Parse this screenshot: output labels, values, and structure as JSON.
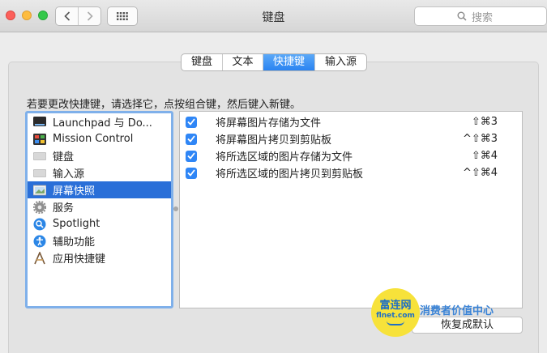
{
  "window": {
    "title": "键盘"
  },
  "search": {
    "placeholder": "搜索"
  },
  "tabs": [
    {
      "label": "键盘",
      "active": false
    },
    {
      "label": "文本",
      "active": false
    },
    {
      "label": "快捷键",
      "active": true
    },
    {
      "label": "输入源",
      "active": false
    }
  ],
  "instruction": "若要更改快捷键，请选择它，点按组合键，然后键入新键。",
  "categories": [
    {
      "label": "Launchpad 与 Do...",
      "icon": "launchpad-icon"
    },
    {
      "label": "Mission Control",
      "icon": "mission-control-icon"
    },
    {
      "label": "键盘",
      "icon": "keyboard-icon"
    },
    {
      "label": "输入源",
      "icon": "input-source-icon"
    },
    {
      "label": "屏幕快照",
      "icon": "screenshot-icon",
      "selected": true
    },
    {
      "label": "服务",
      "icon": "services-gear-icon"
    },
    {
      "label": "Spotlight",
      "icon": "spotlight-icon"
    },
    {
      "label": "辅助功能",
      "icon": "accessibility-icon"
    },
    {
      "label": "应用快捷键",
      "icon": "app-shortcuts-icon"
    }
  ],
  "shortcuts": [
    {
      "label": "将屏幕图片存储为文件",
      "keys": "⇧⌘3",
      "checked": true
    },
    {
      "label": "将屏幕图片拷贝到剪贴板",
      "keys": "^⇧⌘3",
      "checked": true
    },
    {
      "label": "将所选区域的图片存储为文件",
      "keys": "⇧⌘4",
      "checked": true
    },
    {
      "label": "将所选区域的图片拷贝到剪贴板",
      "keys": "^⇧⌘4",
      "checked": true
    }
  ],
  "restore_button": "恢复成默认",
  "watermark": {
    "logo_line1": "富连网",
    "logo_line2": "flnet.com",
    "slogan": "消费者价值中心"
  },
  "colors": {
    "accent": "#2a83f1",
    "selection": "#2a6fd8",
    "checkbox": "#2f86f6"
  }
}
